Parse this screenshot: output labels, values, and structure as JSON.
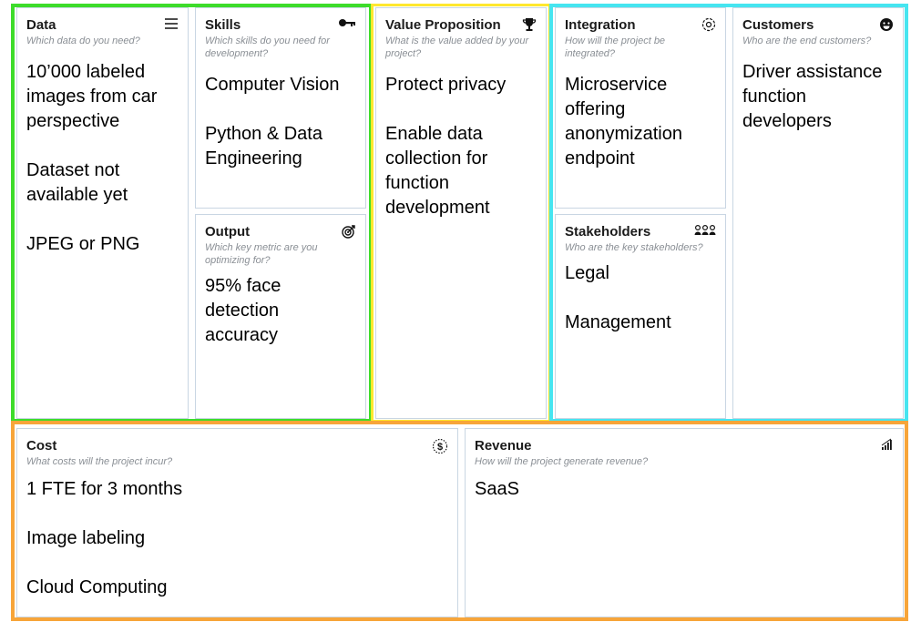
{
  "colors": {
    "green": "#3ddc2b",
    "yellow": "#ffe82e",
    "cyan": "#46e5f0",
    "orange": "#f7a53a"
  },
  "cards": {
    "data": {
      "title": "Data",
      "question": "Which data do you need?",
      "icon": "menu-lines-icon",
      "items": [
        "10’000 labeled images from car perspective",
        "Dataset not available yet",
        "JPEG or PNG"
      ]
    },
    "skills": {
      "title": "Skills",
      "question": "Which skills do you need for development?",
      "icon": "key-icon",
      "items": [
        "Computer Vision",
        "Python & Data Engineering"
      ]
    },
    "output": {
      "title": "Output",
      "question": "Which key metric are you optimizing for?",
      "icon": "target-icon",
      "items": [
        "95% face detection accuracy"
      ]
    },
    "value": {
      "title": "Value Proposition",
      "question": "What is the value added by your project?",
      "icon": "trophy-icon",
      "items": [
        "Protect privacy",
        "Enable data collection for function development"
      ]
    },
    "integration": {
      "title": "Integration",
      "question": "How will the project be integrated?",
      "icon": "puzzle-gear-icon",
      "items": [
        "Microservice offering anonymization endpoint"
      ]
    },
    "stakeholders": {
      "title": "Stakeholders",
      "question": "Who are the key stakeholders?",
      "icon": "people-group-icon",
      "items": [
        "Legal",
        "Management"
      ]
    },
    "customers": {
      "title": "Customers",
      "question": "Who are the end customers?",
      "icon": "smiley-icon",
      "items": [
        "Driver assistance function developers"
      ]
    },
    "cost": {
      "title": "Cost",
      "question": "What costs will the project incur?",
      "icon": "dollar-coin-icon",
      "items": [
        "1 FTE for 3 months",
        "Image labeling",
        "Cloud Computing"
      ]
    },
    "revenue": {
      "title": "Revenue",
      "question": "How will the project generate revenue?",
      "icon": "growth-bars-icon",
      "items": [
        "SaaS"
      ]
    }
  }
}
